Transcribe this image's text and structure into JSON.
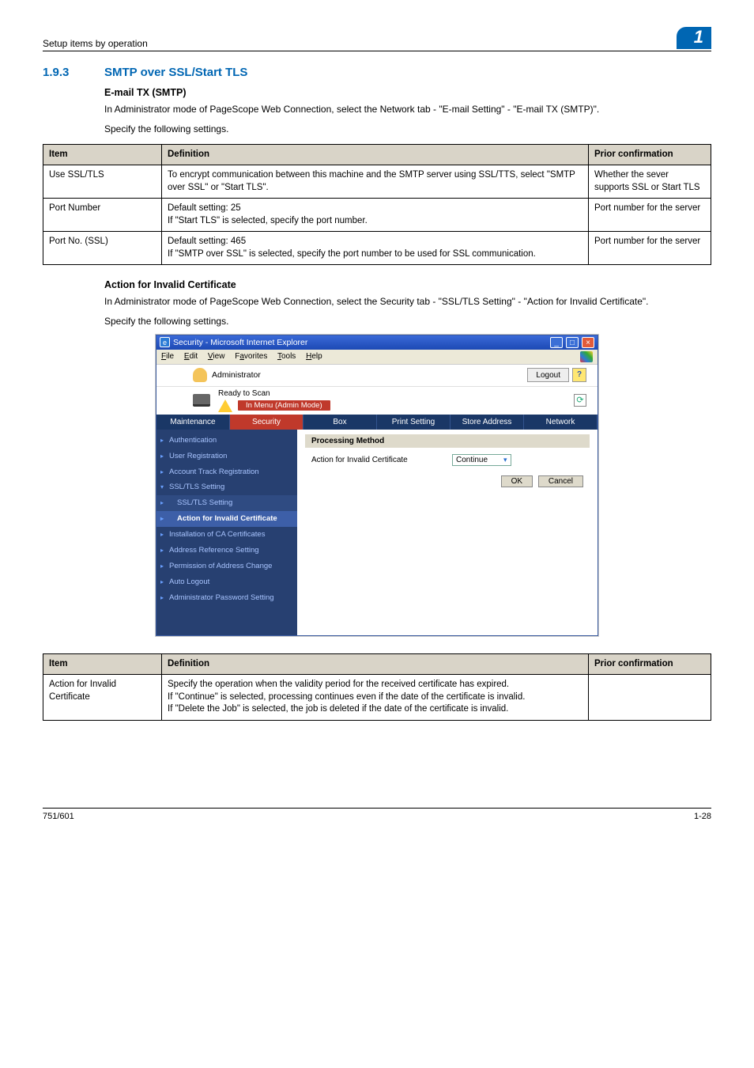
{
  "page": {
    "header_left": "Setup items by operation",
    "header_badge": "1",
    "section_num": "1.9.3",
    "section_title": "SMTP over SSL/Start TLS",
    "h4_1": "E-mail TX (SMTP)",
    "p1": "In Administrator mode of PageScope Web Connection, select the Network tab - \"E-mail Setting\" - \"E-mail TX (SMTP)\".",
    "p2": "Specify the following settings.",
    "h4_2": "Action for Invalid Certificate",
    "p3": "In Administrator mode of PageScope Web Connection, select the Security tab - \"SSL/TLS Setting\" - \"Action for Invalid Certificate\".",
    "p4": "Specify the following settings.",
    "footer_left": "751/601",
    "footer_right": "1-28"
  },
  "table1": {
    "headers": [
      "Item",
      "Definition",
      "Prior confirmation"
    ],
    "rows": [
      {
        "c1": "Use SSL/TLS",
        "c2": "To encrypt communication between this machine and the SMTP server using SSL/TTS, select \"SMTP over SSL\" or \"Start TLS\".",
        "c3": "Whether the sever supports SSL or Start TLS"
      },
      {
        "c1": "Port Number",
        "c2": "Default setting: 25\nIf \"Start TLS\" is selected, specify the port number.",
        "c3": "Port number for the server"
      },
      {
        "c1": "Port No. (SSL)",
        "c2": "Default setting: 465\nIf \"SMTP over SSL\" is selected, specify the port number to be used for SSL communication.",
        "c3": "Port number for the server"
      }
    ]
  },
  "table2": {
    "headers": [
      "Item",
      "Definition",
      "Prior confirmation"
    ],
    "rows": [
      {
        "c1": "Action for Invalid Certificate",
        "c2": "Specify the operation when the validity period for the received certificate has expired.\nIf \"Continue\" is selected, processing continues even if the date of the certificate is invalid.\nIf \"Delete the Job\" is selected, the job is deleted if the date of the certificate is invalid.",
        "c3": ""
      }
    ]
  },
  "ie": {
    "title": "Security - Microsoft Internet Explorer",
    "menu": {
      "file": "File",
      "edit": "Edit",
      "view": "View",
      "favorites": "Favorites",
      "tools": "Tools",
      "help": "Help"
    },
    "admin_label": "Administrator",
    "logout": "Logout",
    "help_q": "?",
    "ready": "Ready to Scan",
    "menu_mode": "In Menu (Admin Mode)",
    "refresh_glyph": "⟳",
    "tabs": [
      "Maintenance",
      "Security",
      "Box",
      "Print Setting",
      "Store Address",
      "Network"
    ],
    "active_tab_index": 1,
    "sidebar": {
      "items": [
        {
          "label": "Authentication"
        },
        {
          "label": "User Registration"
        },
        {
          "label": "Account Track Registration"
        },
        {
          "label": "SSL/TLS Setting",
          "expanded": true,
          "subs": [
            {
              "label": "SSL/TLS Setting"
            },
            {
              "label": "Action for Invalid Certificate",
              "active": true
            }
          ]
        },
        {
          "label": "Installation of CA Certificates"
        },
        {
          "label": "Address Reference Setting"
        },
        {
          "label": "Permission of Address Change"
        },
        {
          "label": "Auto Logout"
        },
        {
          "label": "Administrator Password Setting"
        }
      ]
    },
    "content": {
      "bar": "Processing Method",
      "field_label": "Action for Invalid Certificate",
      "select_value": "Continue",
      "ok": "OK",
      "cancel": "Cancel"
    }
  }
}
